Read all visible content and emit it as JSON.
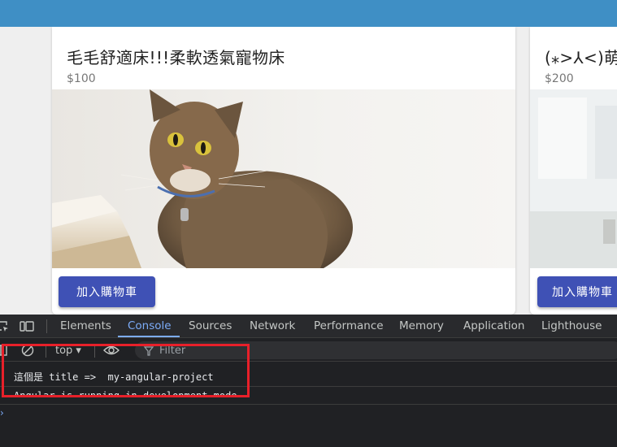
{
  "cards": [
    {
      "title": "毛毛舒適床!!!柔軟透氣寵物床",
      "price": "$100",
      "button": "加入購物車"
    },
    {
      "title": "(⁎>⅄<)萌",
      "price": "$200",
      "button": "加入購物車"
    }
  ],
  "devtools": {
    "tabs": [
      "Elements",
      "Console",
      "Sources",
      "Network",
      "Performance",
      "Memory",
      "Application",
      "Lighthouse"
    ],
    "active_tab": "Console",
    "context": "top ▾",
    "filter_placeholder": "Filter",
    "log_prefix": "這個是",
    "log_title": "title =>  my-angular-project",
    "log_angular": "Angular is running in development mode.",
    "prompt": "›"
  },
  "colors": {
    "header": "#3f8fc5",
    "button": "#3f51b5",
    "highlight": "#e8202a",
    "active_tab": "#7cacf8"
  }
}
